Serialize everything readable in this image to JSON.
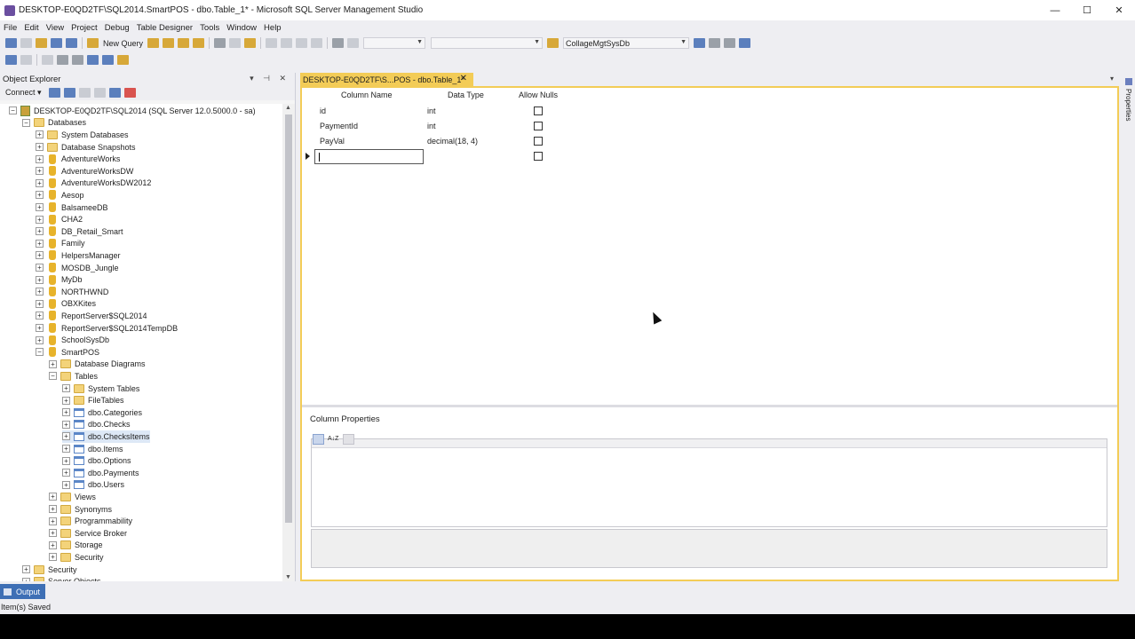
{
  "window": {
    "title": "DESKTOP-E0QD2TF\\SQL2014.SmartPOS - dbo.Table_1* - Microsoft SQL Server Management Studio",
    "minimize": "—",
    "maximize": "☐",
    "close": "✕"
  },
  "menu": [
    "File",
    "Edit",
    "View",
    "Project",
    "Debug",
    "Table Designer",
    "Tools",
    "Window",
    "Help"
  ],
  "toolbar": {
    "new_query": "New Query",
    "database_combo": "CollageMgtSysDb"
  },
  "object_explorer": {
    "title": "Object Explorer",
    "connect": "Connect ▾",
    "tree": [
      {
        "label": "DESKTOP-E0QD2TF\\SQL2014 (SQL Server 12.0.5000.0 - sa)",
        "level": 0,
        "icon": "server-icon",
        "expanded": true
      },
      {
        "label": "Databases",
        "level": 1,
        "icon": "folder-icon",
        "expanded": true
      },
      {
        "label": "System Databases",
        "level": 2,
        "icon": "folder-icon",
        "expanded": false
      },
      {
        "label": "Database Snapshots",
        "level": 2,
        "icon": "folder-icon",
        "expanded": false
      },
      {
        "label": "AdventureWorks",
        "level": 2,
        "icon": "database-icon",
        "expanded": false
      },
      {
        "label": "AdventureWorksDW",
        "level": 2,
        "icon": "database-icon",
        "expanded": false
      },
      {
        "label": "AdventureWorksDW2012",
        "level": 2,
        "icon": "database-icon",
        "expanded": false
      },
      {
        "label": "Aesop",
        "level": 2,
        "icon": "database-icon",
        "expanded": false
      },
      {
        "label": "BalsameeDB",
        "level": 2,
        "icon": "database-icon",
        "expanded": false
      },
      {
        "label": "CHA2",
        "level": 2,
        "icon": "database-icon",
        "expanded": false
      },
      {
        "label": "DB_Retail_Smart",
        "level": 2,
        "icon": "database-icon",
        "expanded": false
      },
      {
        "label": "Family",
        "level": 2,
        "icon": "database-icon",
        "expanded": false
      },
      {
        "label": "HelpersManager",
        "level": 2,
        "icon": "database-icon",
        "expanded": false
      },
      {
        "label": "MOSDB_Jungle",
        "level": 2,
        "icon": "database-icon",
        "expanded": false
      },
      {
        "label": "MyDb",
        "level": 2,
        "icon": "database-icon",
        "expanded": false
      },
      {
        "label": "NORTHWND",
        "level": 2,
        "icon": "database-icon",
        "expanded": false
      },
      {
        "label": "OBXKites",
        "level": 2,
        "icon": "database-icon",
        "expanded": false
      },
      {
        "label": "ReportServer$SQL2014",
        "level": 2,
        "icon": "database-icon",
        "expanded": false
      },
      {
        "label": "ReportServer$SQL2014TempDB",
        "level": 2,
        "icon": "database-icon",
        "expanded": false
      },
      {
        "label": "SchoolSysDb",
        "level": 2,
        "icon": "database-icon",
        "expanded": false
      },
      {
        "label": "SmartPOS",
        "level": 2,
        "icon": "database-icon",
        "expanded": true
      },
      {
        "label": "Database Diagrams",
        "level": 3,
        "icon": "folder-icon",
        "expanded": false
      },
      {
        "label": "Tables",
        "level": 3,
        "icon": "folder-icon",
        "expanded": true
      },
      {
        "label": "System Tables",
        "level": 4,
        "icon": "folder-icon",
        "expanded": false
      },
      {
        "label": "FileTables",
        "level": 4,
        "icon": "folder-icon",
        "expanded": false
      },
      {
        "label": "dbo.Categories",
        "level": 4,
        "icon": "table-icon",
        "expanded": false
      },
      {
        "label": "dbo.Checks",
        "level": 4,
        "icon": "table-icon",
        "expanded": false
      },
      {
        "label": "dbo.ChecksItems",
        "level": 4,
        "icon": "table-icon",
        "expanded": false,
        "selected": true
      },
      {
        "label": "dbo.Items",
        "level": 4,
        "icon": "table-icon",
        "expanded": false
      },
      {
        "label": "dbo.Options",
        "level": 4,
        "icon": "table-icon",
        "expanded": false
      },
      {
        "label": "dbo.Payments",
        "level": 4,
        "icon": "table-icon",
        "expanded": false
      },
      {
        "label": "dbo.Users",
        "level": 4,
        "icon": "table-icon",
        "expanded": false
      },
      {
        "label": "Views",
        "level": 3,
        "icon": "folder-icon",
        "expanded": false
      },
      {
        "label": "Synonyms",
        "level": 3,
        "icon": "folder-icon",
        "expanded": false
      },
      {
        "label": "Programmability",
        "level": 3,
        "icon": "folder-icon",
        "expanded": false
      },
      {
        "label": "Service Broker",
        "level": 3,
        "icon": "folder-icon",
        "expanded": false
      },
      {
        "label": "Storage",
        "level": 3,
        "icon": "folder-icon",
        "expanded": false
      },
      {
        "label": "Security",
        "level": 3,
        "icon": "folder-icon",
        "expanded": false
      },
      {
        "label": "Security",
        "level": 1,
        "icon": "folder-icon",
        "expanded": false
      },
      {
        "label": "Server Objects",
        "level": 1,
        "icon": "folder-icon",
        "expanded": false
      }
    ]
  },
  "document": {
    "tab_label": "DESKTOP-E0QD2TF\\S...POS - dbo.Table_1*",
    "tab_close": "✕",
    "columns_header": {
      "name": "Column Name",
      "type": "Data Type",
      "nulls": "Allow Nulls"
    },
    "rows": [
      {
        "name": "id",
        "type": "int",
        "allow_nulls": false
      },
      {
        "name": "PaymentId",
        "type": "int",
        "allow_nulls": false
      },
      {
        "name": "PayVal",
        "type": "decimal(18, 4)",
        "allow_nulls": false
      }
    ],
    "new_row": {
      "name": "",
      "type": "",
      "allow_nulls": false
    },
    "column_properties_title": "Column Properties",
    "sort_alpha_label": "A↓Z"
  },
  "right_rail": {
    "label": "Properties"
  },
  "output": {
    "tab_label": "Output"
  },
  "status": {
    "text": "Item(s) Saved"
  },
  "colors": {
    "tab_active": "#f3cc57",
    "output_tab": "#3e6fb5",
    "chrome": "#eeeef2"
  }
}
